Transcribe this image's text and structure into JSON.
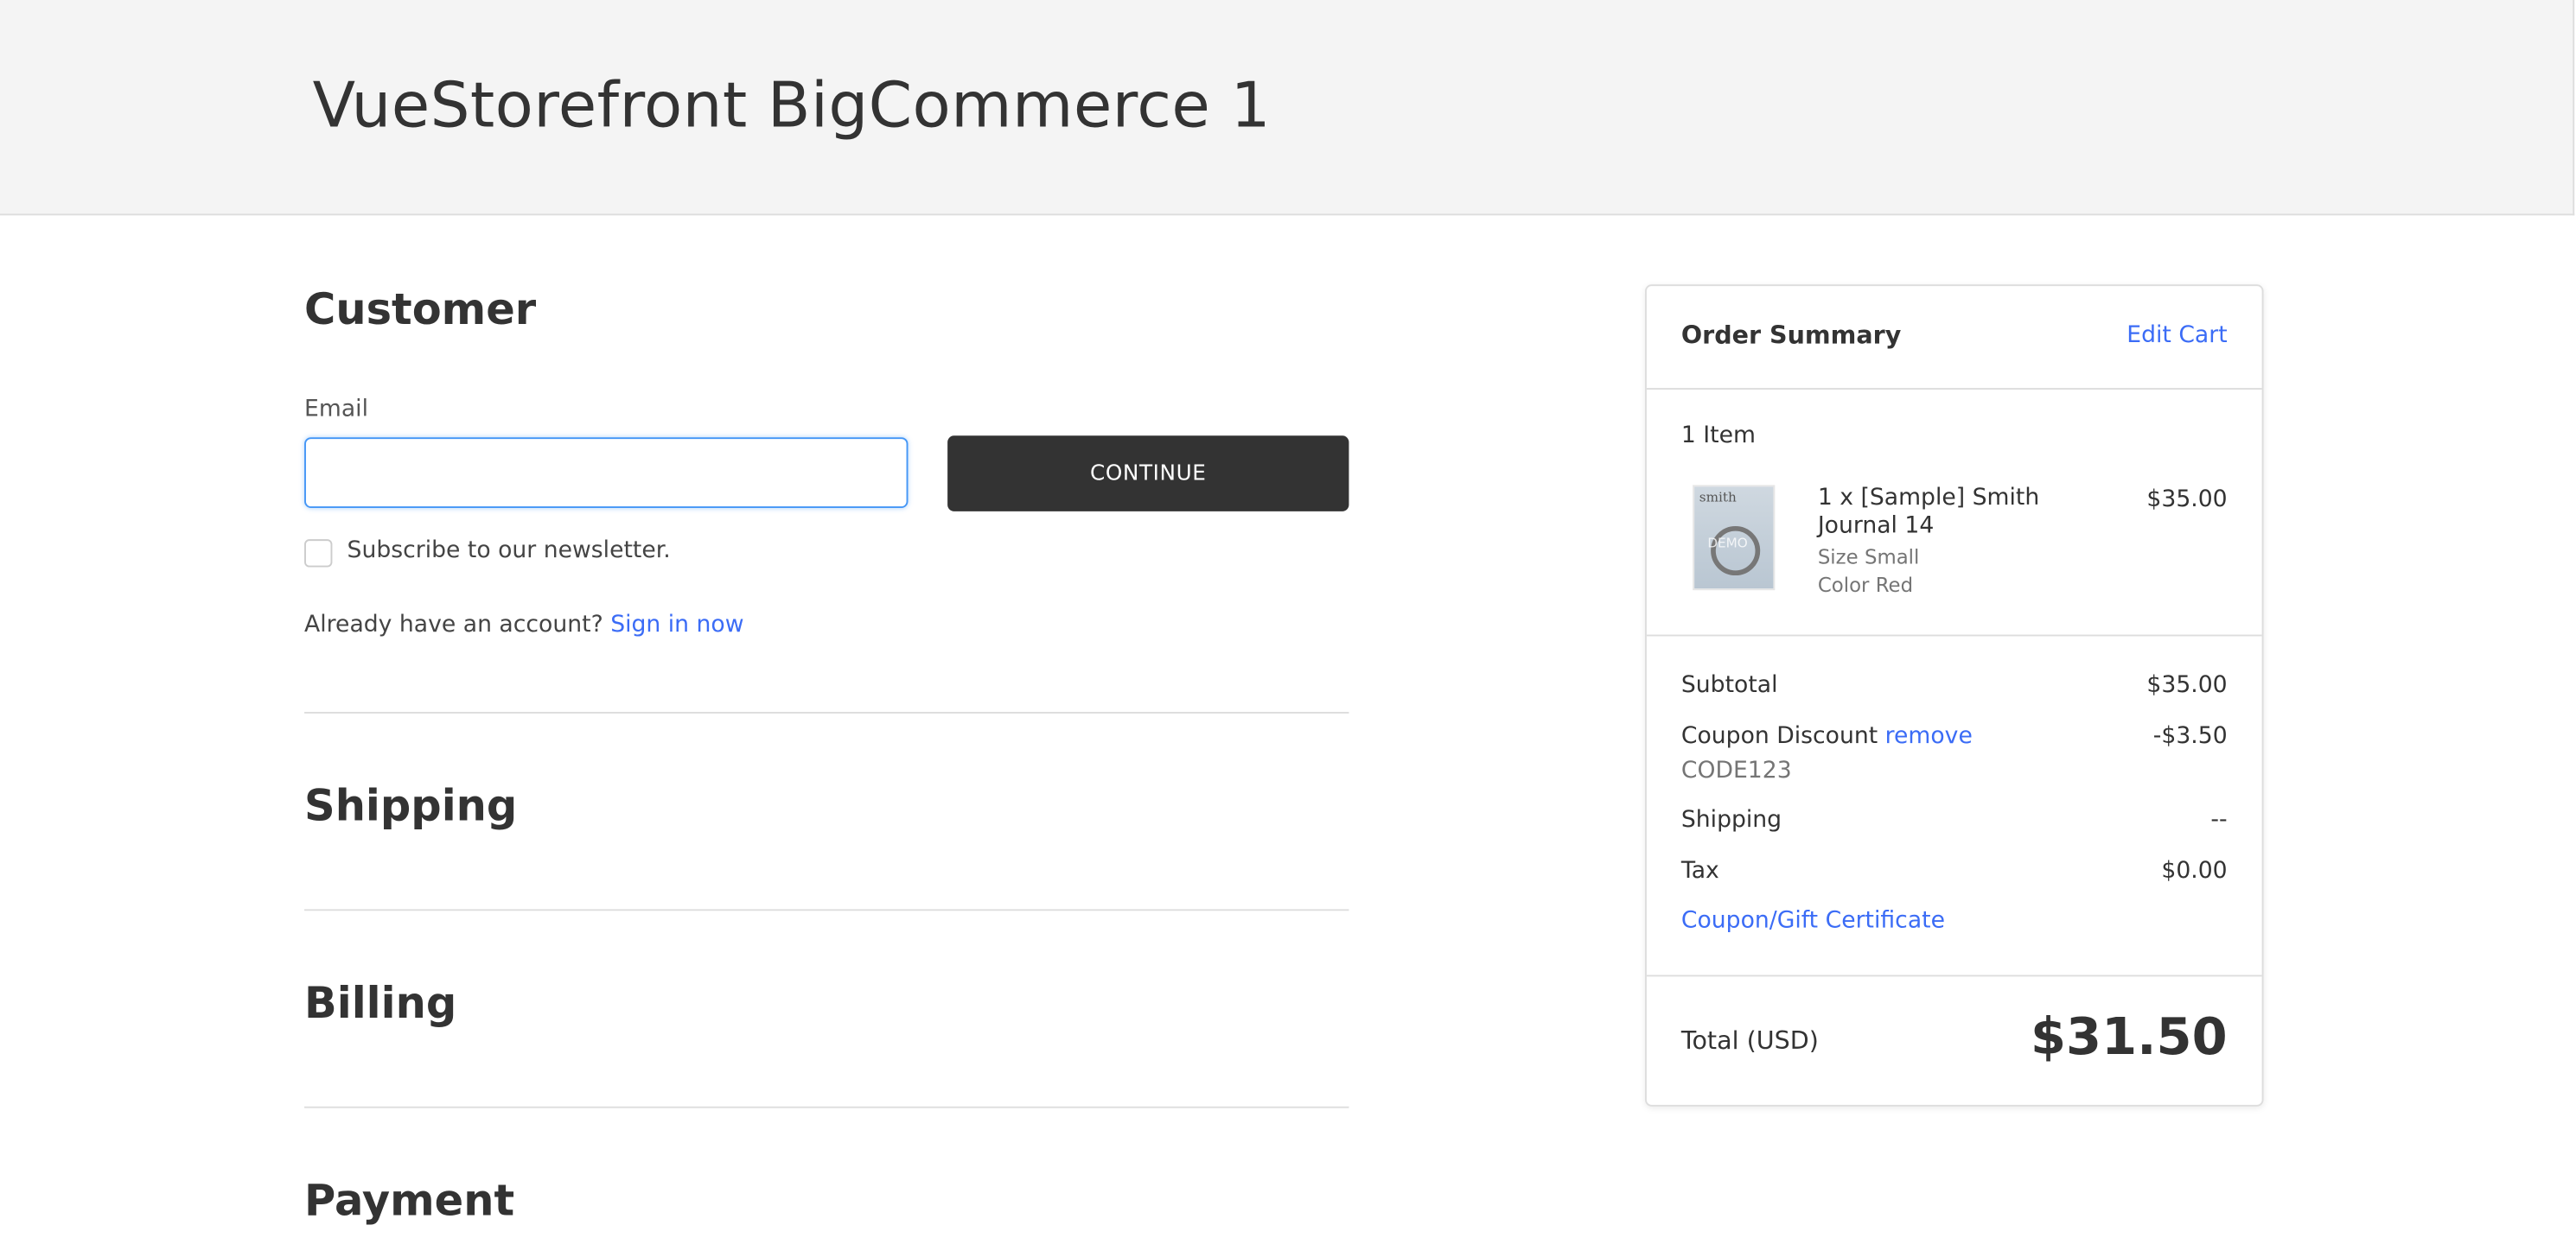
{
  "header": {
    "title": "VueStorefront BigCommerce 1"
  },
  "customer": {
    "heading": "Customer",
    "email_label": "Email",
    "email_value": "",
    "continue_label": "CONTINUE",
    "newsletter_label": "Subscribe to our newsletter.",
    "newsletter_checked": false,
    "account_prompt": "Already have an account?",
    "sign_in_label": "Sign in now"
  },
  "sections": {
    "shipping": "Shipping",
    "billing": "Billing",
    "payment": "Payment"
  },
  "summary": {
    "title": "Order Summary",
    "edit_cart": "Edit Cart",
    "item_count": "1 Item",
    "items": [
      {
        "name_line1": "1 x [Sample] Smith",
        "name_line2": "Journal 14",
        "size": "Size Small",
        "color": "Color Red",
        "price": "$35.00",
        "image_text": "smith",
        "image_watermark": "DEMO"
      }
    ],
    "subtotal_label": "Subtotal",
    "subtotal": "$35.00",
    "coupon_label": "Coupon Discount",
    "coupon_remove": "remove",
    "coupon_code": "CODE123",
    "coupon_value": "-$3.50",
    "shipping_label": "Shipping",
    "shipping": "--",
    "tax_label": "Tax",
    "tax": "$0.00",
    "gift_link": "Coupon/Gift Certificate",
    "total_label": "Total (USD)",
    "total": "$31.50"
  },
  "colors": {
    "accent": "#3b6cf6",
    "button": "#333333",
    "focus": "#4496f6"
  }
}
